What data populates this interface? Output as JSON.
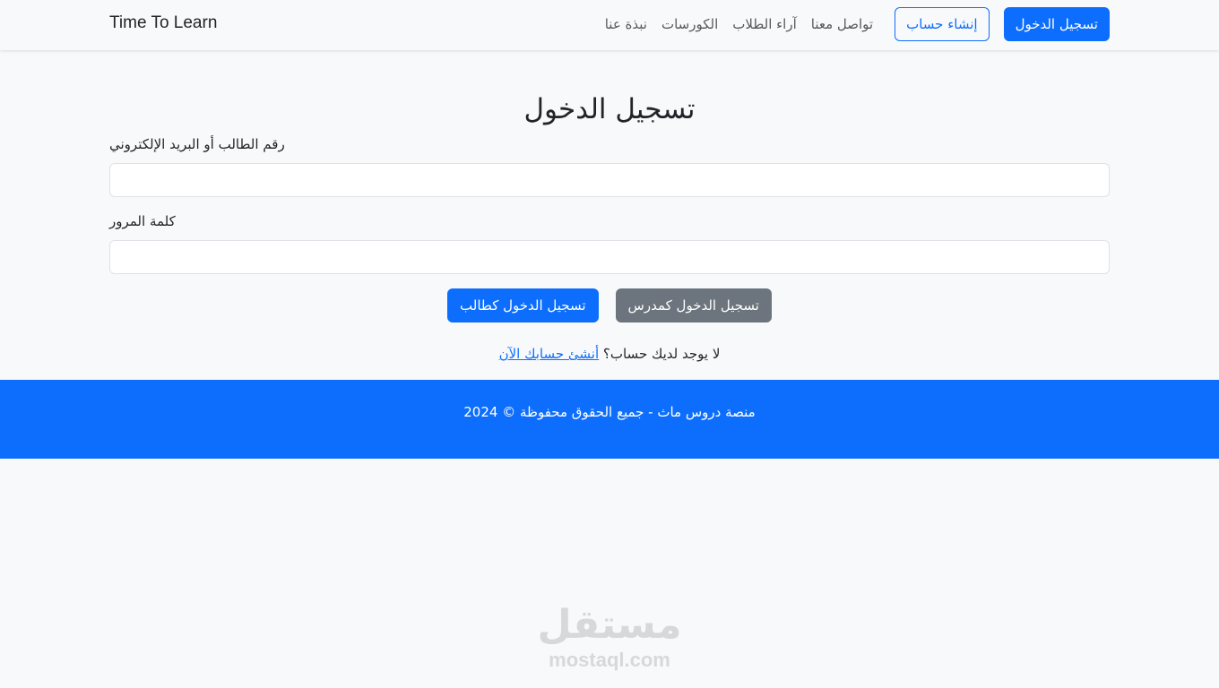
{
  "navbar": {
    "brand": "Time To Learn",
    "login_button": "تسجيل الدخول",
    "signup_button": "إنشاء حساب",
    "links": [
      "تواصل معنا",
      "آراء الطلاب",
      "الكورسات",
      "نبذة عنا"
    ]
  },
  "form": {
    "title": "تسجيل الدخول",
    "id_label": "رقم الطالب أو البريد الإلكتروني",
    "id_value": "",
    "password_label": "كلمة المرور",
    "password_value": "",
    "student_login_button": "تسجيل الدخول كطالب",
    "teacher_login_button": "تسجيل الدخول كمدرس",
    "no_account_text": "لا يوجد لديك حساب؟ ",
    "signup_link": "أنشئ حسابك الآن"
  },
  "footer": {
    "text": "منصة دروس ماث - جميع الحقوق محفوظة © 2024"
  },
  "watermark": {
    "arabic": "مستقل",
    "latin": "mostaql.com"
  },
  "colors": {
    "primary": "#0d6efd",
    "secondary": "#6c757d",
    "background": "#f8f9fa"
  }
}
